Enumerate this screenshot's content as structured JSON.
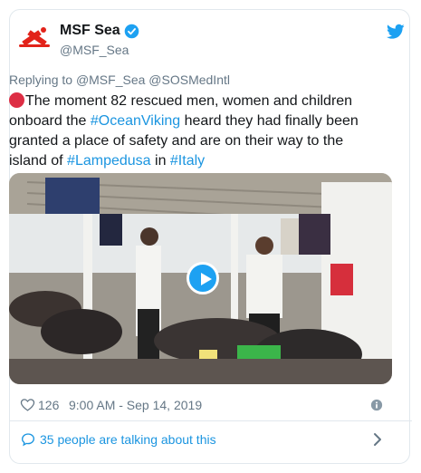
{
  "account": {
    "name": "MSF Sea",
    "handle": "@MSF_Sea"
  },
  "reply": {
    "prefix": "Replying to",
    "to1": "@MSF_Sea",
    "to2": "@SOSMedIntl"
  },
  "tweet": {
    "part1": "The moment 82 rescued men, women and children onboard the ",
    "tag1": "#OceanViking",
    "part2": " heard they had finally been granted a place of safety and are on their way to the island of ",
    "tag2": "#Lampedusa",
    "part3": " in ",
    "tag3": "#Italy"
  },
  "stats": {
    "likes": "126",
    "timestamp": "9:00 AM - Sep 14, 2019"
  },
  "footer": {
    "talking": "35 people are talking about this"
  },
  "icons": [
    "msf-logo-icon",
    "verified-icon",
    "twitter-bird-icon",
    "red-circle-emoji-icon",
    "play-icon",
    "heart-icon",
    "info-icon",
    "speech-bubble-icon",
    "chevron-right-icon"
  ],
  "colors": {
    "link": "#1b95e0",
    "muted": "#657786",
    "brand_red": "#e2231a",
    "twitter_blue": "#1da1f2"
  }
}
